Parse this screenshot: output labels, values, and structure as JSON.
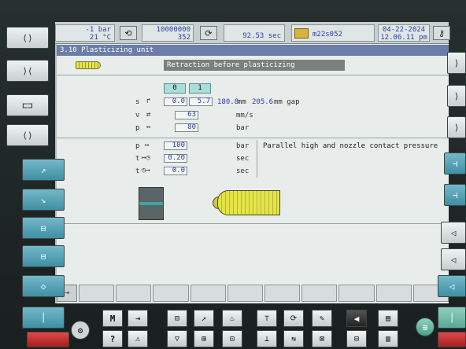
{
  "status": {
    "pressure": "-1 bar",
    "temperature": "21 °C",
    "counter_top": "10000000",
    "counter_bottom": "352",
    "cycle_time": "92.53 sec",
    "program": "m22s052",
    "date": "04-22-2024",
    "time": "12.06.11 pm"
  },
  "title": "3.10 Plasticizing unit",
  "section": "Retraction before plasticizing",
  "stages": [
    "0",
    "1"
  ],
  "rows": [
    {
      "sym": "s",
      "unit": "mm",
      "v0": "0.0",
      "v1": "5.7"
    },
    {
      "sym": "v",
      "unit": "mm/s",
      "v1": "63"
    },
    {
      "sym": "p",
      "unit": "bar",
      "v1": "80"
    }
  ],
  "stroke_extra": {
    "value": "180.8",
    "unit": "mm",
    "gap_value": "205.6",
    "gap_label": "mm gap"
  },
  "contact_rows": [
    {
      "sym": "p",
      "value": "100",
      "unit": "bar"
    },
    {
      "sym": "t",
      "value": "0.20",
      "unit": "sec"
    },
    {
      "sym": "t",
      "value": "0.0",
      "unit": "sec"
    }
  ],
  "contact_note": "Parallel high and nozzle contact pressure",
  "bottom_keys": [
    "M",
    "?"
  ],
  "colors": {
    "accent": "#6c7ea8",
    "value_blue": "#2b3fa8",
    "stage": "#a9dfd8"
  }
}
